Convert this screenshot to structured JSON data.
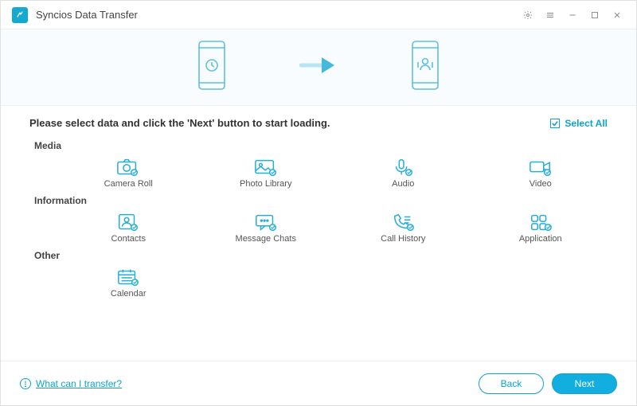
{
  "header": {
    "title": "Syncios Data Transfer"
  },
  "content": {
    "instruction": "Please select data and click the 'Next' button to start loading.",
    "select_all_label": "Select All",
    "sections": {
      "media": {
        "title": "Media",
        "items": [
          "Camera Roll",
          "Photo Library",
          "Audio",
          "Video"
        ]
      },
      "information": {
        "title": "Information",
        "items": [
          "Contacts",
          "Message Chats",
          "Call History",
          "Application"
        ]
      },
      "other": {
        "title": "Other",
        "items": [
          "Calendar"
        ]
      }
    }
  },
  "footer": {
    "help_link": "What can I transfer?",
    "back": "Back",
    "next": "Next"
  },
  "colors": {
    "accent": "#0ea3cf"
  }
}
